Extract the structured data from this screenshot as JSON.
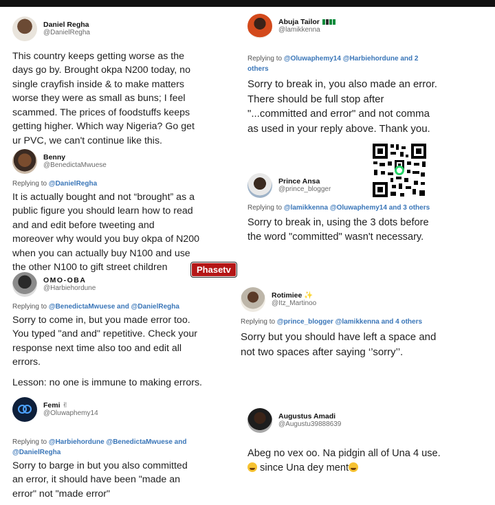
{
  "cards": {
    "daniel": {
      "name": "Daniel Regha",
      "handle": "@DanielRegha",
      "text": "This country keeps getting worse as the\ndays go by. Brought okpa N200 today, no\nsingle crayfish inside & to make matters\nworse they were as small as buns; I feel\nscammed. The prices of foodstuffs keeps\ngetting higher. Which way Nigeria? Go get\nur PVC, we can't continue like this."
    },
    "benny": {
      "name": "Benny",
      "handle": "@BenedictaMwuese",
      "reply_prefix": "Replying to",
      "reply_links": "@DanielRegha",
      "text": "It is actually bought and not “brought” as a\npublic figure you should learn how to read\nand and edit before tweeting  and\nmoreover why would you buy okpa of N200\nwhen you can actually buy N100 and use\nthe other N100 to gift street children"
    },
    "omooba": {
      "name": "OMO-OBA",
      "handle": "@Harbiehordune",
      "reply_prefix": "Replying to",
      "reply_links": "@BenedictaMwuese and @DanielRegha",
      "text": "Sorry to come in, but you made error too.\nYou typed \"and and\" repetitive. Check your\nresponse next time also too and edit all\nerrors.",
      "lesson": "Lesson: no one is immune to making errors."
    },
    "femi": {
      "name": "Femi",
      "handle": "@Oluwaphemy14",
      "reply_prefix": "Replying to",
      "reply_links": "@Harbiehordune @BenedictaMwuese and\n@DanielRegha",
      "text": "Sorry to barge in but you also committed\nan error, it should have been \"made an\nerror\" not \"made error\""
    },
    "abuja": {
      "name": "Abuja Tailor",
      "handle": "@lamikkenna",
      "reply_prefix": "Replying to",
      "reply_links": "@Oluwaphemy14 @Harbiehordune and 2\nothers",
      "text": "Sorry to break in, you also made an error.\nThere should be full stop after\n\"...committed and error\" and not comma\nas used in your reply above. Thank you."
    },
    "prince": {
      "name": "Prince Ansa",
      "handle": "@prince_blogger",
      "reply_prefix": "Replying to",
      "reply_links": "@lamikkenna @Oluwaphemy14 and 3 others",
      "text": "Sorry  to break in, using the 3 dots before\nthe word \"committed\" wasn't necessary."
    },
    "rotimiee": {
      "name": "Rotimiee",
      "handle": "@Itz_Martinoo",
      "reply_prefix": "Replying to",
      "reply_links": "@prince_blogger @lamikkenna and 4 others",
      "text": "Sorry but you should have left a space and\nnot two spaces after saying ‘’sorry’’."
    },
    "augustus": {
      "name": "Augustus Amadi",
      "handle": "@Augustu39888639",
      "text_line1": "Abeg no vex oo. Na pidgin all of Una  4 use.",
      "text_line2": " since Una dey ment"
    }
  },
  "watermark": "Phasetv",
  "icons": {
    "qr": "qr-code-icon",
    "emoji": "laughing-emoji-icon"
  },
  "colors": {
    "link": "#3a76b8",
    "watermark_bg": "#b41616",
    "flag_green": "#0b8a3a"
  }
}
